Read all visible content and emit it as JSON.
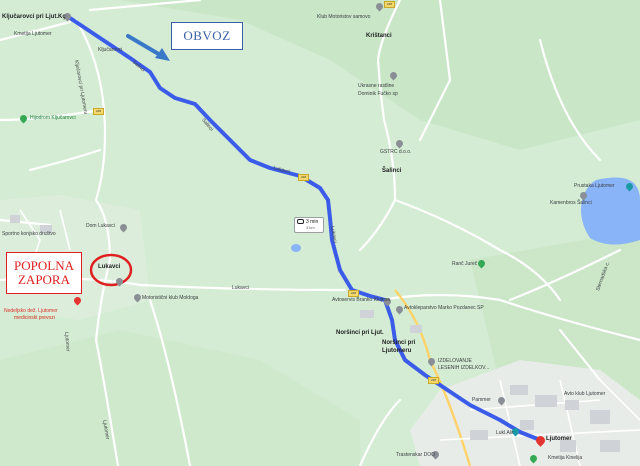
{
  "map": {
    "callouts": {
      "bypass": "OBVOZ",
      "closure_line1": "POPOLNA",
      "closure_line2": "ZAPORA"
    },
    "route_badge": {
      "time": "3 min",
      "distance": "3 km"
    },
    "places": {
      "kljucarovci_top": "Ključarovci pri Ljut.Kç",
      "klub_motoristov": "Klub Motoristov samovo",
      "kljucarovci_road": "Ključarovci",
      "kristanci": "Krištanci",
      "kmetija": "Kmetija Ljutomer",
      "ukrasne": "Ukrasne rastline",
      "domink": "Dominik Fučko sp",
      "hijodrom": "Hijodrom Ključarovci",
      "gstrc": "GSTRC d.o.o.",
      "salinci": "Šalinci",
      "prustaka": "Prustaka Ljutomer",
      "kamenbros": "Kamenbros Šalinci",
      "sportno": "Sportno konjsko društvo",
      "dom_lukavci": "Dom Lukavci",
      "lukavci_village": "Lukavci",
      "ranc_jurec": "Ranč Jureč",
      "lukavci_road": "Lukavci",
      "motoristicni": "Motoristični klub Moldoga",
      "nedeljski": "Nedeljsko dež. Ljutomer",
      "medicinski": "medicinski prevozi",
      "avtoservis": "Avtoservis Branko Klujnsa",
      "avtokleparstvo": "Avtokleparstvo Marko Pozdanec SP",
      "norsinci": "Noršinci pri Ljut.",
      "norsinci2": "Noršinci pri",
      "ljutomeru": "Ljutomeru",
      "izdelovanje": "IZDELOVANJE",
      "lesenih": "LESENIH IZDELKOV...",
      "pammer": "Pammer",
      "avto_klub": "Avto klub Ljutomer",
      "ljutomer": "Ljutomer",
      "luklar": "Lukl.Alir",
      "trastenskar": "Trastenskar DOO",
      "kinelija": "Kmetija Kinelija"
    },
    "road_labels": {
      "r1": "Ključarovci pri Ljutomeru",
      "r2": "Salinci",
      "r3": "Salinci",
      "r4": "Lukavci",
      "r5": "Lukavci",
      "r6": "Ljutomer",
      "r7": "Sternadska c.",
      "r8": "Ljutomer"
    },
    "shields": {
      "s1": "228",
      "s2": "228",
      "s3": "228",
      "s4": "228",
      "s5": "228"
    },
    "colors": {
      "route": "#3b5ce8",
      "bypass_arrow": "#3a78c8",
      "closure": "#e02020",
      "water": "#8ab4f8",
      "land": "#d4ecd3"
    },
    "icons": {
      "poi": "map-pin-icon",
      "car": "car-icon",
      "destination": "destination-pin-icon"
    }
  }
}
